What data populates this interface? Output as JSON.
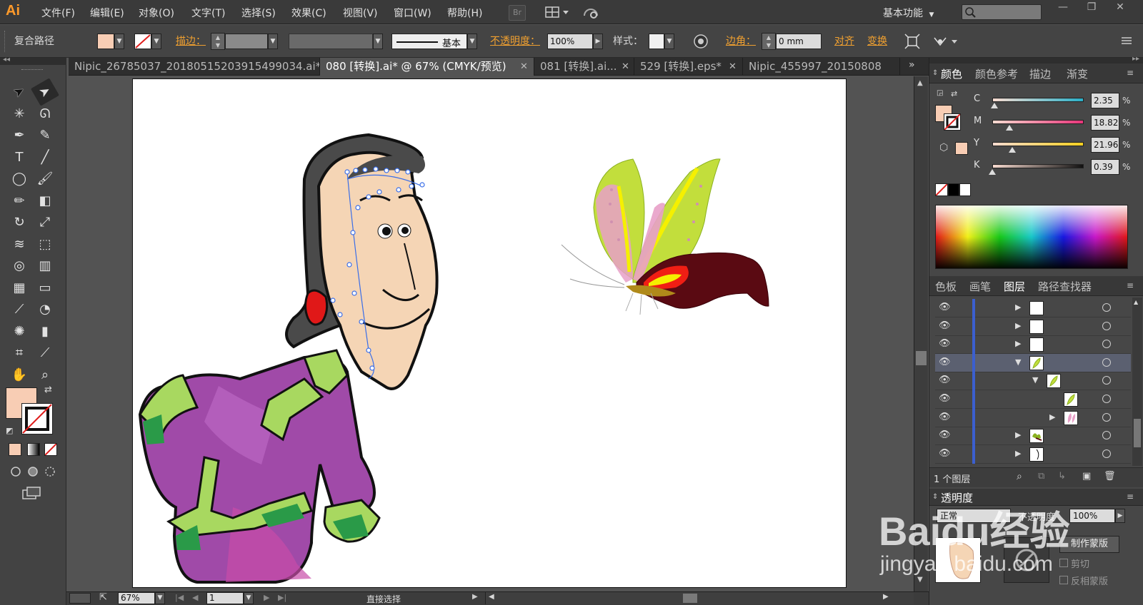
{
  "app": {
    "logo": "Ai"
  },
  "menu": [
    "文件(F)",
    "编辑(E)",
    "对象(O)",
    "文字(T)",
    "选择(S)",
    "效果(C)",
    "视图(V)",
    "窗口(W)",
    "帮助(H)"
  ],
  "menubar_buttons": {
    "bridge": "Br",
    "arrange_icon": "arrange-documents-icon",
    "sync_icon": "sync-icon"
  },
  "workspace": {
    "label": "基本功能"
  },
  "window_controls": {
    "minimize": "—",
    "restore": "❐",
    "close": "✕"
  },
  "control_bar": {
    "selection_type": "复合路径",
    "fill_color": "#f8cdb4",
    "stroke_label": "描边：",
    "stroke_profile": "基本",
    "opacity_label": "不透明度：",
    "opacity_value": "100%",
    "style_label": "样式：",
    "corner_label": "边角：",
    "corner_value": "0 mm",
    "align_label": "对齐",
    "transform_label": "变换"
  },
  "tabs": [
    {
      "label": "Nipic_26785037_20180515203915499034.ai*",
      "active": false
    },
    {
      "label": "080 [转换].ai* @ 67% (CMYK/预览)",
      "active": true
    },
    {
      "label": "081 [转换].ai...",
      "active": false
    },
    {
      "label": "529 [转换].eps*",
      "active": false
    },
    {
      "label": "Nipic_455997_20150808",
      "active": false
    }
  ],
  "tools": {
    "fill_color": "#f8cdb4",
    "items": [
      "selection-tool",
      "direct-selection-tool",
      "magic-wand-tool",
      "lasso-tool",
      "pen-tool",
      "curvature-tool",
      "type-tool",
      "line-tool",
      "ellipse-tool",
      "paintbrush-tool",
      "pencil-tool",
      "eraser-tool",
      "rotate-tool",
      "scale-tool",
      "warp-tool",
      "free-transform-tool",
      "shape-builder-tool",
      "column-graph-tool",
      "mesh-tool",
      "gradient-tool",
      "eyedropper-tool",
      "blend-tool",
      "symbol-sprayer-tool",
      "bar-graph-tool",
      "artboard-tool",
      "slice-tool",
      "hand-tool",
      "zoom-tool"
    ]
  },
  "status": {
    "zoom": "67%",
    "page": "1",
    "tool_name": "直接选择"
  },
  "color_panel": {
    "tabs": [
      "颜色",
      "颜色参考",
      "描边",
      "渐变"
    ],
    "sliders": [
      {
        "label": "C",
        "value": "2.35",
        "fraction": 0.0235,
        "gradient": [
          "#f8dbd0",
          "#2ab0c8"
        ]
      },
      {
        "label": "M",
        "value": "18.82",
        "fraction": 0.1882,
        "gradient": [
          "#f8dbd0",
          "#e8357a"
        ]
      },
      {
        "label": "Y",
        "value": "21.96",
        "fraction": 0.2196,
        "gradient": [
          "#f8dbd0",
          "#f5d020"
        ]
      },
      {
        "label": "K",
        "value": "0.39",
        "fraction": 0.0039,
        "gradient": [
          "#f8dbd0",
          "#111111"
        ]
      }
    ],
    "percent_sign": "%"
  },
  "layers_panel": {
    "tabs": [
      "色板",
      "画笔",
      "图层",
      "路径查找器"
    ],
    "rows": [
      {
        "expand": "▶",
        "indent": 0,
        "highlight": false,
        "thumb": "white"
      },
      {
        "expand": "▶",
        "indent": 0,
        "highlight": false,
        "thumb": "white"
      },
      {
        "expand": "▶",
        "indent": 0,
        "highlight": false,
        "thumb": "white"
      },
      {
        "expand": "▼",
        "indent": 0,
        "highlight": true,
        "thumb": "wing"
      },
      {
        "expand": "▼",
        "indent": 1,
        "highlight": false,
        "thumb": "wing"
      },
      {
        "expand": "",
        "indent": 2,
        "highlight": false,
        "thumb": "wing"
      },
      {
        "expand": "▶",
        "indent": 2,
        "highlight": false,
        "thumb": "wing-pink"
      },
      {
        "expand": "▶",
        "indent": 0,
        "highlight": false,
        "thumb": "butterfly"
      },
      {
        "expand": "▶",
        "indent": 0,
        "highlight": false,
        "thumb": "face"
      }
    ],
    "count": "1 个图层"
  },
  "transparency_panel": {
    "title": "透明度",
    "mode": "正常",
    "opacity_label": "不透明度",
    "opacity_value": "100%",
    "make_mask": "制作蒙版",
    "clip": "剪切",
    "invert_mask": "反相蒙版"
  },
  "watermark": {
    "text": "Baidu经验",
    "url": "jingyan.baidu.com"
  }
}
